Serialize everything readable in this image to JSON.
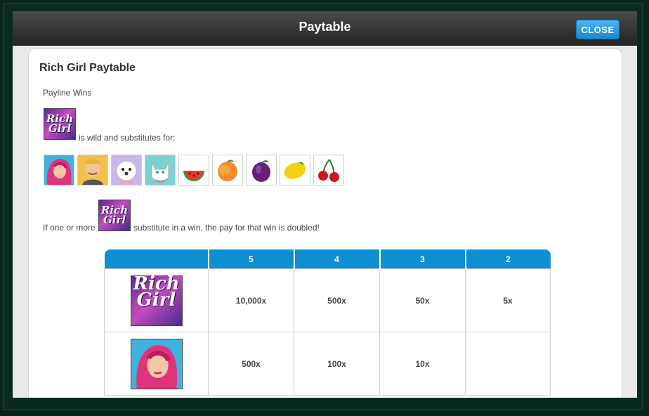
{
  "window": {
    "title": "Paytable",
    "close_label": "CLOSE"
  },
  "paytable": {
    "heading": "Rich Girl Paytable",
    "section": "Payline Wins",
    "wild_logo": "Rich Girl",
    "wild_text": "is wild and substitutes for:",
    "substituted_symbols": [
      {
        "name": "rich-girl-woman-icon"
      },
      {
        "name": "butler-icon"
      },
      {
        "name": "white-dog-icon"
      },
      {
        "name": "white-cat-icon"
      },
      {
        "name": "watermelon-icon"
      },
      {
        "name": "peach-icon"
      },
      {
        "name": "plum-icon"
      },
      {
        "name": "lemon-icon"
      },
      {
        "name": "cherries-icon"
      }
    ],
    "double_prefix": "If one or more",
    "double_suffix": "substitute in a win, the pay for that win is doubled!",
    "table": {
      "columns": [
        "5",
        "4",
        "3",
        "2"
      ],
      "rows": [
        {
          "symbol": "rich-girl-logo-icon",
          "pays": [
            "10,000x",
            "500x",
            "50x",
            "5x"
          ]
        },
        {
          "symbol": "rich-girl-woman-icon",
          "pays": [
            "500x",
            "100x",
            "10x",
            ""
          ]
        }
      ]
    }
  },
  "colors": {
    "header_blue": "#0f8fd3",
    "close_button": "#2a9be0",
    "background": "#07241a"
  }
}
